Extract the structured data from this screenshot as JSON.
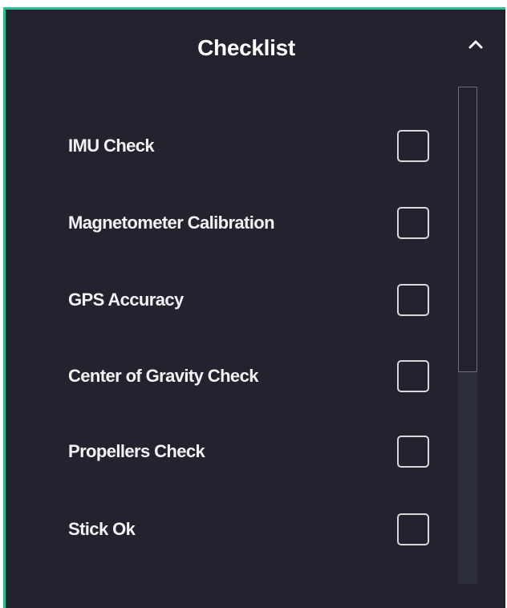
{
  "panel": {
    "title": "Checklist",
    "accent_color": "#2bbf8f",
    "background_color": "#22232f",
    "collapse_icon": "chevron-up-icon"
  },
  "checklist": {
    "items": [
      {
        "label": "IMU Check",
        "checked": false
      },
      {
        "label": "Magnetometer Calibration",
        "checked": false
      },
      {
        "label": "GPS Accuracy",
        "checked": false
      },
      {
        "label": "Center of Gravity Check",
        "checked": false
      },
      {
        "label": "Propellers Check",
        "checked": false
      },
      {
        "label": "Stick Ok",
        "checked": false
      }
    ]
  }
}
